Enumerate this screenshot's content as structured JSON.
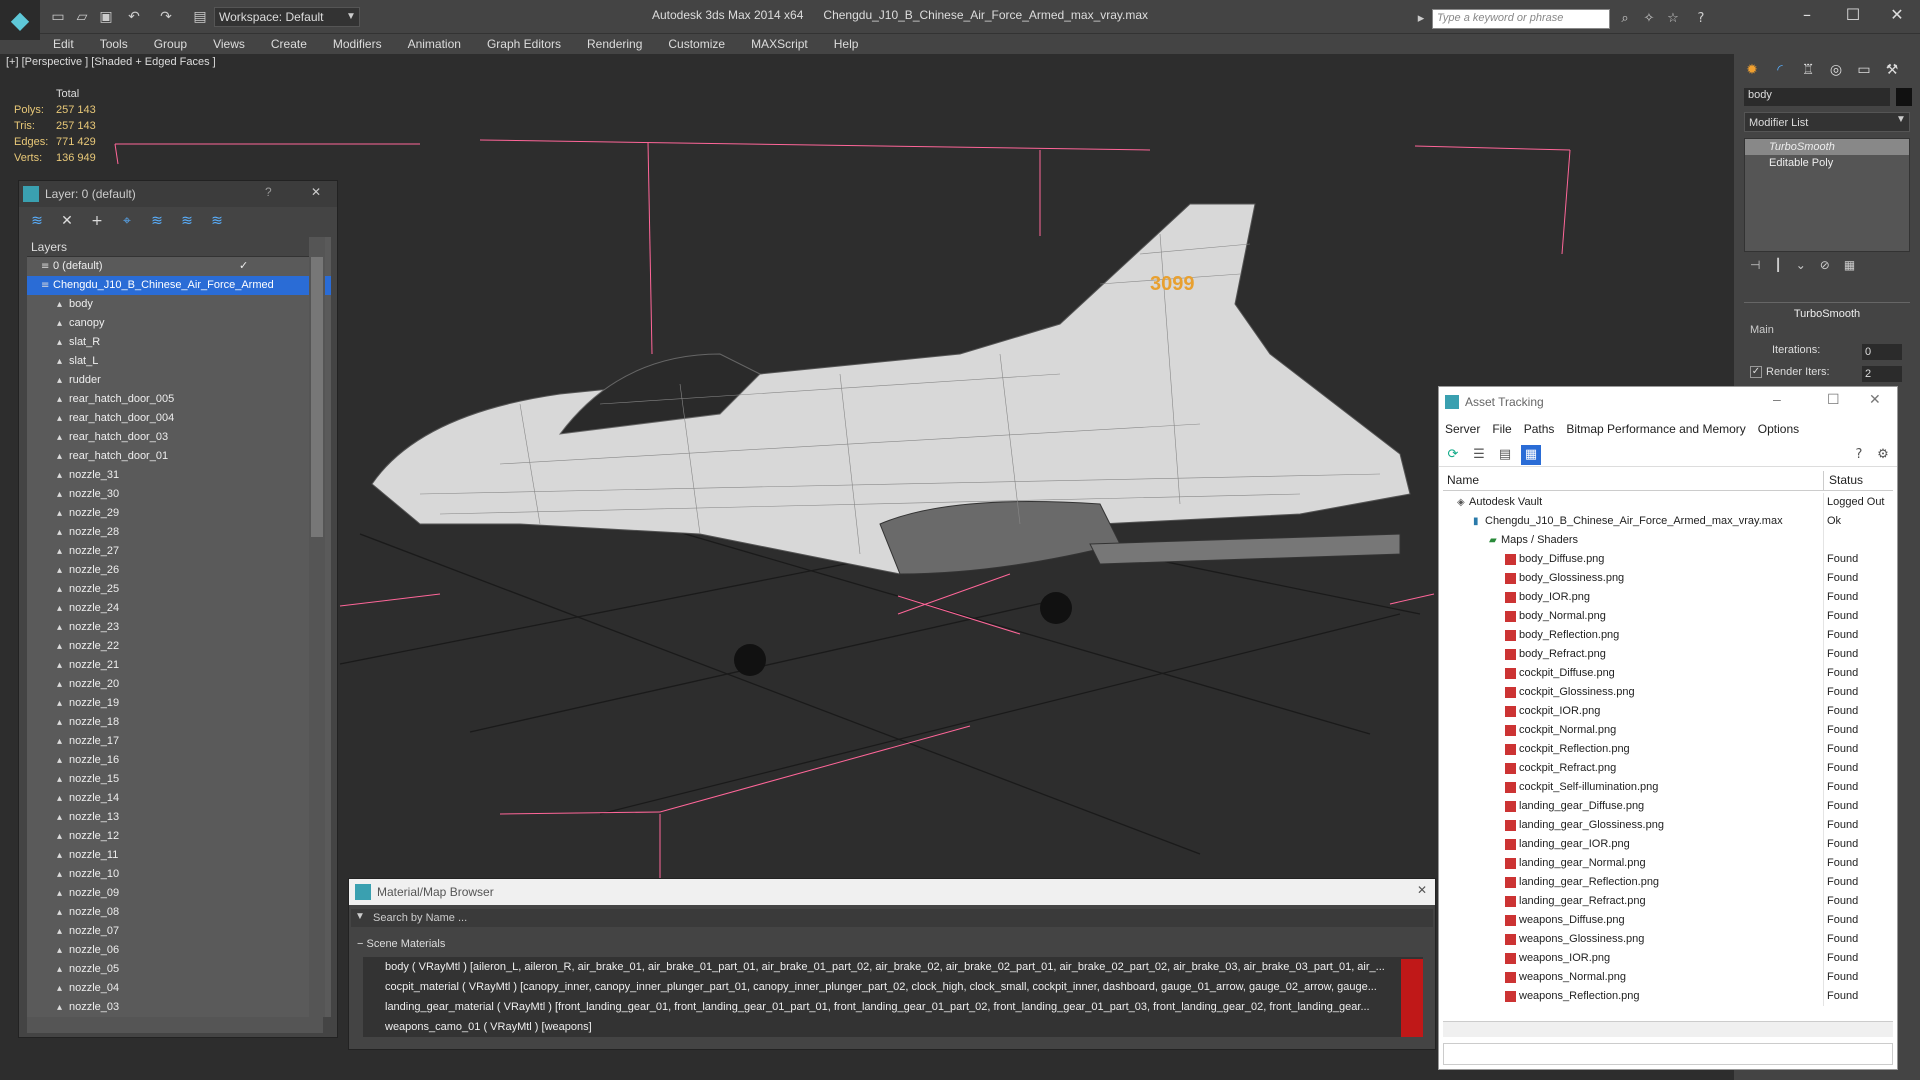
{
  "app": {
    "title": "Autodesk 3ds Max  2014 x64",
    "file": "Chengdu_J10_B_Chinese_Air_Force_Armed_max_vray.max",
    "workspace": "Workspace: Default",
    "search_placeholder": "Type a keyword or phrase"
  },
  "menu": [
    "Edit",
    "Tools",
    "Group",
    "Views",
    "Create",
    "Modifiers",
    "Animation",
    "Graph Editors",
    "Rendering",
    "Customize",
    "MAXScript",
    "Help"
  ],
  "viewport": {
    "label": "[+] [Perspective ] [Shaded + Edged Faces ]",
    "stats": {
      "header": "Total",
      "rows": [
        {
          "label": "Polys:",
          "value": "257 143"
        },
        {
          "label": "Tris:",
          "value": "257 143"
        },
        {
          "label": "Edges:",
          "value": "771 429"
        },
        {
          "label": "Verts:",
          "value": "136 949"
        }
      ]
    },
    "tail_code": "3099"
  },
  "layer_panel": {
    "title": "Layer: 0 (default)",
    "help": "?",
    "close": "✕",
    "header": "Layers",
    "layers": [
      {
        "name": "0 (default)",
        "level": 1,
        "selected": false,
        "check": "✓"
      },
      {
        "name": "Chengdu_J10_B_Chinese_Air_Force_Armed",
        "level": 1,
        "selected": true,
        "check": ""
      },
      {
        "name": "body",
        "level": 2
      },
      {
        "name": "canopy",
        "level": 2
      },
      {
        "name": "slat_R",
        "level": 2
      },
      {
        "name": "slat_L",
        "level": 2
      },
      {
        "name": "rudder",
        "level": 2
      },
      {
        "name": "rear_hatch_door_005",
        "level": 2
      },
      {
        "name": "rear_hatch_door_004",
        "level": 2
      },
      {
        "name": "rear_hatch_door_03",
        "level": 2
      },
      {
        "name": "rear_hatch_door_01",
        "level": 2
      },
      {
        "name": "nozzle_31",
        "level": 2
      },
      {
        "name": "nozzle_30",
        "level": 2
      },
      {
        "name": "nozzle_29",
        "level": 2
      },
      {
        "name": "nozzle_28",
        "level": 2
      },
      {
        "name": "nozzle_27",
        "level": 2
      },
      {
        "name": "nozzle_26",
        "level": 2
      },
      {
        "name": "nozzle_25",
        "level": 2
      },
      {
        "name": "nozzle_24",
        "level": 2
      },
      {
        "name": "nozzle_23",
        "level": 2
      },
      {
        "name": "nozzle_22",
        "level": 2
      },
      {
        "name": "nozzle_21",
        "level": 2
      },
      {
        "name": "nozzle_20",
        "level": 2
      },
      {
        "name": "nozzle_19",
        "level": 2
      },
      {
        "name": "nozzle_18",
        "level": 2
      },
      {
        "name": "nozzle_17",
        "level": 2
      },
      {
        "name": "nozzle_16",
        "level": 2
      },
      {
        "name": "nozzle_15",
        "level": 2
      },
      {
        "name": "nozzle_14",
        "level": 2
      },
      {
        "name": "nozzle_13",
        "level": 2
      },
      {
        "name": "nozzle_12",
        "level": 2
      },
      {
        "name": "nozzle_11",
        "level": 2
      },
      {
        "name": "nozzle_10",
        "level": 2
      },
      {
        "name": "nozzle_09",
        "level": 2
      },
      {
        "name": "nozzle_08",
        "level": 2
      },
      {
        "name": "nozzle_07",
        "level": 2
      },
      {
        "name": "nozzle_06",
        "level": 2
      },
      {
        "name": "nozzle_05",
        "level": 2
      },
      {
        "name": "nozzle_04",
        "level": 2
      },
      {
        "name": "nozzle_03",
        "level": 2
      }
    ]
  },
  "material_browser": {
    "title": "Material/Map Browser",
    "search_placeholder": "Search by Name ...",
    "section": "Scene Materials",
    "materials": [
      "body  ( VRayMtl ) [aileron_L, aileron_R, air_brake_01, air_brake_01_part_01, air_brake_01_part_02, air_brake_02, air_brake_02_part_01, air_brake_02_part_02, air_brake_03, air_brake_03_part_01, air_...",
      "cocpit_material  ( VRayMtl ) [canopy_inner, canopy_inner_plunger_part_01, canopy_inner_plunger_part_02, clock_high, clock_small, cockpit_inner, dashboard, gauge_01_arrow, gauge_02_arrow, gauge...",
      "landing_gear_material  ( VRayMtl ) [front_landing_gear_01, front_landing_gear_01_part_01, front_landing_gear_01_part_02, front_landing_gear_01_part_03, front_landing_gear_02, front_landing_gear...",
      "weapons_camo_01  ( VRayMtl ) [weapons]"
    ]
  },
  "command_panel": {
    "object_name": "body",
    "modifier_list": "Modifier List",
    "stack": [
      {
        "name": "TurboSmooth",
        "selected": true
      },
      {
        "name": "Editable Poly",
        "selected": false
      }
    ],
    "rollout": "TurboSmooth",
    "group": "Main",
    "iterations_label": "Iterations:",
    "iterations": "0",
    "render_iters_label": "Render Iters:",
    "render_iters": "2"
  },
  "asset_tracking": {
    "title": "Asset Tracking",
    "menu": [
      "Server",
      "File",
      "Paths",
      "Bitmap Performance and Memory",
      "Options"
    ],
    "columns": {
      "name": "Name",
      "status": "Status"
    },
    "rows": [
      {
        "name": "Autodesk Vault",
        "status": "Logged Out",
        "level": 0,
        "type": "vault"
      },
      {
        "name": "Chengdu_J10_B_Chinese_Air_Force_Armed_max_vray.max",
        "status": "Ok",
        "level": 1,
        "type": "max"
      },
      {
        "name": "Maps / Shaders",
        "status": "",
        "level": 2,
        "type": "folder"
      },
      {
        "name": "body_Diffuse.png",
        "status": "Found",
        "level": 3,
        "type": "png"
      },
      {
        "name": "body_Glossiness.png",
        "status": "Found",
        "level": 3,
        "type": "png"
      },
      {
        "name": "body_IOR.png",
        "status": "Found",
        "level": 3,
        "type": "png"
      },
      {
        "name": "body_Normal.png",
        "status": "Found",
        "level": 3,
        "type": "png"
      },
      {
        "name": "body_Reflection.png",
        "status": "Found",
        "level": 3,
        "type": "png"
      },
      {
        "name": "body_Refract.png",
        "status": "Found",
        "level": 3,
        "type": "png"
      },
      {
        "name": "cockpit_Diffuse.png",
        "status": "Found",
        "level": 3,
        "type": "png"
      },
      {
        "name": "cockpit_Glossiness.png",
        "status": "Found",
        "level": 3,
        "type": "png"
      },
      {
        "name": "cockpit_IOR.png",
        "status": "Found",
        "level": 3,
        "type": "png"
      },
      {
        "name": "cockpit_Normal.png",
        "status": "Found",
        "level": 3,
        "type": "png"
      },
      {
        "name": "cockpit_Reflection.png",
        "status": "Found",
        "level": 3,
        "type": "png"
      },
      {
        "name": "cockpit_Refract.png",
        "status": "Found",
        "level": 3,
        "type": "png"
      },
      {
        "name": "cockpit_Self-illumination.png",
        "status": "Found",
        "level": 3,
        "type": "png"
      },
      {
        "name": "landing_gear_Diffuse.png",
        "status": "Found",
        "level": 3,
        "type": "png"
      },
      {
        "name": "landing_gear_Glossiness.png",
        "status": "Found",
        "level": 3,
        "type": "png"
      },
      {
        "name": "landing_gear_IOR.png",
        "status": "Found",
        "level": 3,
        "type": "png"
      },
      {
        "name": "landing_gear_Normal.png",
        "status": "Found",
        "level": 3,
        "type": "png"
      },
      {
        "name": "landing_gear_Reflection.png",
        "status": "Found",
        "level": 3,
        "type": "png"
      },
      {
        "name": "landing_gear_Refract.png",
        "status": "Found",
        "level": 3,
        "type": "png"
      },
      {
        "name": "weapons_Diffuse.png",
        "status": "Found",
        "level": 3,
        "type": "png"
      },
      {
        "name": "weapons_Glossiness.png",
        "status": "Found",
        "level": 3,
        "type": "png"
      },
      {
        "name": "weapons_IOR.png",
        "status": "Found",
        "level": 3,
        "type": "png"
      },
      {
        "name": "weapons_Normal.png",
        "status": "Found",
        "level": 3,
        "type": "png"
      },
      {
        "name": "weapons_Reflection.png",
        "status": "Found",
        "level": 3,
        "type": "png"
      }
    ]
  },
  "colors": {
    "accent": "#2a6cd6",
    "stats_text": "#e8c878",
    "grid_line": "#ff6699",
    "tail_code": "#e8a030"
  }
}
